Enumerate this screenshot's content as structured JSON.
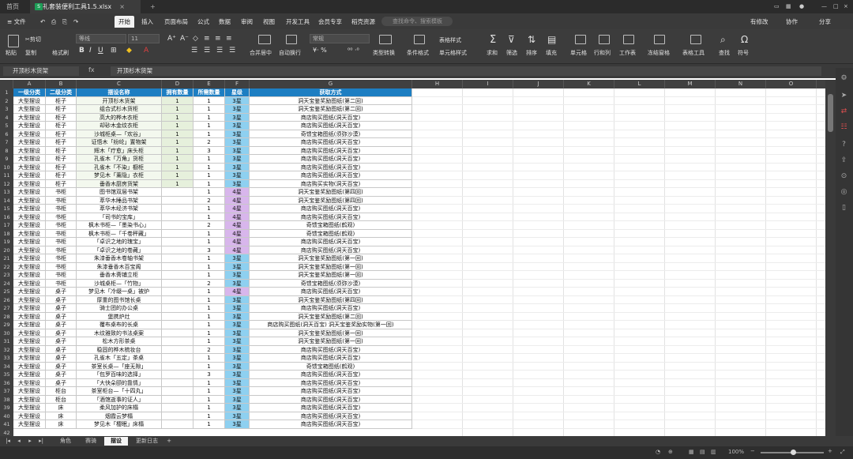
{
  "titlebar": {
    "home_tab": "首页",
    "file_tab": "赠礼套装便利工具1.5.xlsx",
    "new_tab": "+"
  },
  "menubar": {
    "file": "文件",
    "items": [
      "开始",
      "插入",
      "页面布局",
      "公式",
      "数据",
      "审阅",
      "视图",
      "开发工具",
      "会员专享",
      "稻壳资源"
    ],
    "active": "开始",
    "search_placeholder": "查找命令、搜索模板",
    "right": [
      "有修改",
      "协作",
      "分享"
    ]
  },
  "toolbar": {
    "paste": "粘贴",
    "cut": "剪切",
    "copy": "复制",
    "format_painter": "格式刷",
    "font_name": "等线",
    "font_size": "11",
    "merge": "合并居中",
    "wrap": "自动换行",
    "number_format": "常规",
    "type_convert": "类型转换",
    "conditional": "条件格式",
    "table_style": "表格样式",
    "cell_style": "单元格样式",
    "sum": "求和",
    "filter": "筛选",
    "sort": "排序",
    "fill": "填充",
    "cell": "单元格",
    "row_col": "行和列",
    "worksheet": "工作表",
    "freeze": "冻结窗格",
    "table_tools": "表格工具",
    "find": "查找",
    "symbol": "符号"
  },
  "formula": {
    "namebox": "开顶杉木货架",
    "fx": "fx",
    "content": "开顶杉木货架"
  },
  "columns": [
    "A",
    "B",
    "C",
    "D",
    "E",
    "F",
    "G",
    "H",
    "I",
    "J",
    "K",
    "L",
    "M",
    "N",
    "O"
  ],
  "header": [
    "一级分类",
    "二级分类",
    "摆设名称",
    "拥有数量",
    "所需数量",
    "星级",
    "获取方式"
  ],
  "rows": [
    [
      "大型摆设",
      "柜子",
      "开顶杉木货架",
      "1",
      "1",
      "3星",
      "洞天宝鉴奖励图纸(第二回)"
    ],
    [
      "大型摆设",
      "柜子",
      "组合式杉木货柜",
      "1",
      "1",
      "3星",
      "洞天宝鉴奖励图纸(第二回)"
    ],
    [
      "大型摆设",
      "柜子",
      "高大的桦木衣柜",
      "1",
      "1",
      "3星",
      "商店购买图纸(洞天百宝)"
    ],
    [
      "大型摆设",
      "柜子",
      "却砂木金纹衣柜",
      "1",
      "1",
      "3星",
      "商店购买图纸(洞天百宝)"
    ],
    [
      "大型摆设",
      "柜子",
      "沙城柜桌—「欢谷」",
      "1",
      "1",
      "3星",
      "奇馈宝箱图纸(须弥沙漠)"
    ],
    [
      "大型摆设",
      "柜子",
      "证悟木「纷纶」置物架",
      "1",
      "2",
      "3星",
      "商店购买图纸(洞天百宝)"
    ],
    [
      "大型摆设",
      "柜子",
      "辉木「疗愈」床头柜",
      "1",
      "3",
      "3星",
      "商店购买图纸(洞天百宝)"
    ],
    [
      "大型摆设",
      "柜子",
      "孔雀木「万角」货柜",
      "1",
      "1",
      "3星",
      "商店购买图纸(洞天百宝)"
    ],
    [
      "大型摆设",
      "柜子",
      "孔雀木「不染」橱柜",
      "1",
      "1",
      "3星",
      "商店购买图纸(洞天百宝)"
    ],
    [
      "大型摆设",
      "柜子",
      "梦见木「薰隐」衣柜",
      "1",
      "1",
      "3星",
      "商店购买图纸(洞天百宝)"
    ],
    [
      "大型摆设",
      "柜子",
      "垂香木厨房货架",
      "1",
      "1",
      "3星",
      "商店购买实物(洞天百宝)"
    ],
    [
      "大型摆设",
      "书柜",
      "图书馆双层书架",
      "",
      "1",
      "4星",
      "洞天宝鉴奖励图纸(第四回)"
    ],
    [
      "大型摆设",
      "书柜",
      "萃华木睡品书架",
      "",
      "2",
      "4星",
      "洞天宝鉴奖励图纸(第四回)"
    ],
    [
      "大型摆设",
      "书柜",
      "萃华木经济书架",
      "",
      "1",
      "4星",
      "商店购买图纸(洞天百宝)"
    ],
    [
      "大型摆设",
      "书柜",
      "「司书的宝库」",
      "",
      "1",
      "4星",
      "商店购买图纸(洞天百宝)"
    ],
    [
      "大型摆设",
      "书柜",
      "枫木书柜—「墨染书心」",
      "",
      "2",
      "4星",
      "奇馈宝箱图纸(鹤观)"
    ],
    [
      "大型摆设",
      "书柜",
      "枫木书柜—「千卷秤藏」",
      "",
      "1",
      "4星",
      "奇馈宝箱图纸(鹤观)"
    ],
    [
      "大型摆设",
      "书柜",
      "「卓识之地的瑰宝」",
      "",
      "1",
      "4星",
      "商店购买图纸(洞天百宝)"
    ],
    [
      "大型摆设",
      "书柜",
      "「卓识之地的卷藏」",
      "",
      "3",
      "4星",
      "商店购买图纸(洞天百宝)"
    ],
    [
      "大型摆设",
      "书柜",
      "朱漆垂香木卷轴书架",
      "",
      "1",
      "3星",
      "洞天宝鉴奖励图纸(第一回)"
    ],
    [
      "大型摆设",
      "书柜",
      "朱漆垂香木百宝阁",
      "",
      "1",
      "3星",
      "洞天宝鉴奖励图纸(第一回)"
    ],
    [
      "大型摆设",
      "书柜",
      "垂香木斋铺立柜",
      "",
      "1",
      "3星",
      "洞天宝鉴奖励图纸(第一回)"
    ],
    [
      "大型摆设",
      "书柜",
      "沙城桌柜—「竹物」",
      "",
      "2",
      "3星",
      "奇馈宝箱图纸(须弥沙漠)"
    ],
    [
      "大型摆设",
      "桌子",
      "梦见木「冷缀一桌」被炉",
      "",
      "1",
      "4星",
      "商店购买图纸(洞天百宝)"
    ],
    [
      "大型摆设",
      "桌子",
      "厚重的图书馆长桌",
      "",
      "1",
      "3星",
      "洞天宝鉴奖励图纸(第四回)"
    ],
    [
      "大型摆设",
      "桌子",
      "骑士团的办公桌",
      "",
      "1",
      "3星",
      "商店购买图纸(洞天百宝)"
    ],
    [
      "大型摆设",
      "桌子",
      "堡携炉灶",
      "",
      "1",
      "3星",
      "洞天宝鉴奖励图纸(第二回)"
    ],
    [
      "大型摆设",
      "桌子",
      "覆布桌布的长桌",
      "",
      "1",
      "3星",
      "商店购买图纸(洞天百宝)  洞天宝鉴奖励实物(第一回)"
    ],
    [
      "大型摆设",
      "桌子",
      "木纹雅致的书法桌案",
      "",
      "1",
      "3星",
      "洞天宝鉴奖励图纸(第一回)"
    ],
    [
      "大型摆设",
      "桌子",
      "松木方形茶桌",
      "",
      "1",
      "3星",
      "洞天宝鉴奖励图纸(第一回)"
    ],
    [
      "大型摆设",
      "桌子",
      "稳固的桦木梳妆台",
      "",
      "2",
      "3星",
      "商店购买图纸(洞天百宝)"
    ],
    [
      "大型摆设",
      "桌子",
      "孔雀木「五定」茶桌",
      "",
      "1",
      "3星",
      "商店购买图纸(洞天百宝)"
    ],
    [
      "大型摆设",
      "桌子",
      "茶室长桌—「座无隙」",
      "",
      "1",
      "3星",
      "奇馈宝箱图纸(鹤观)"
    ],
    [
      "大型摆设",
      "桌子",
      "「包罗百味的选择」",
      "",
      "3",
      "3星",
      "商店购买图纸(洞天百宝)"
    ],
    [
      "大型摆设",
      "桌子",
      "「大快朵颐的靠情」",
      "",
      "1",
      "3星",
      "商店购买图纸(洞天百宝)"
    ],
    [
      "大型摆设",
      "柜台",
      "茶室柜台—「十四丸」",
      "",
      "1",
      "3星",
      "商店购买图纸(洞天百宝)"
    ],
    [
      "大型摆设",
      "柜台",
      "「酒馆逝事的证人」",
      "",
      "1",
      "3星",
      "商店购买图纸(洞天百宝)"
    ],
    [
      "大型摆设",
      "床",
      "柔风加护的床榻",
      "",
      "1",
      "3星",
      "商店购买图纸(洞天百宝)"
    ],
    [
      "大型摆设",
      "床",
      "烟霞云梦榻",
      "",
      "1",
      "3星",
      "商店购买图纸(洞天百宝)"
    ],
    [
      "大型摆设",
      "床",
      "梦见木「樱眠」床榻",
      "",
      "1",
      "3星",
      "商店购买图纸(洞天百宝)"
    ]
  ],
  "sheet_tabs": [
    "角色",
    "赛骑",
    "摆设",
    "更新日志"
  ],
  "active_sheet": "摆设",
  "status": {
    "zoom": "100%"
  }
}
